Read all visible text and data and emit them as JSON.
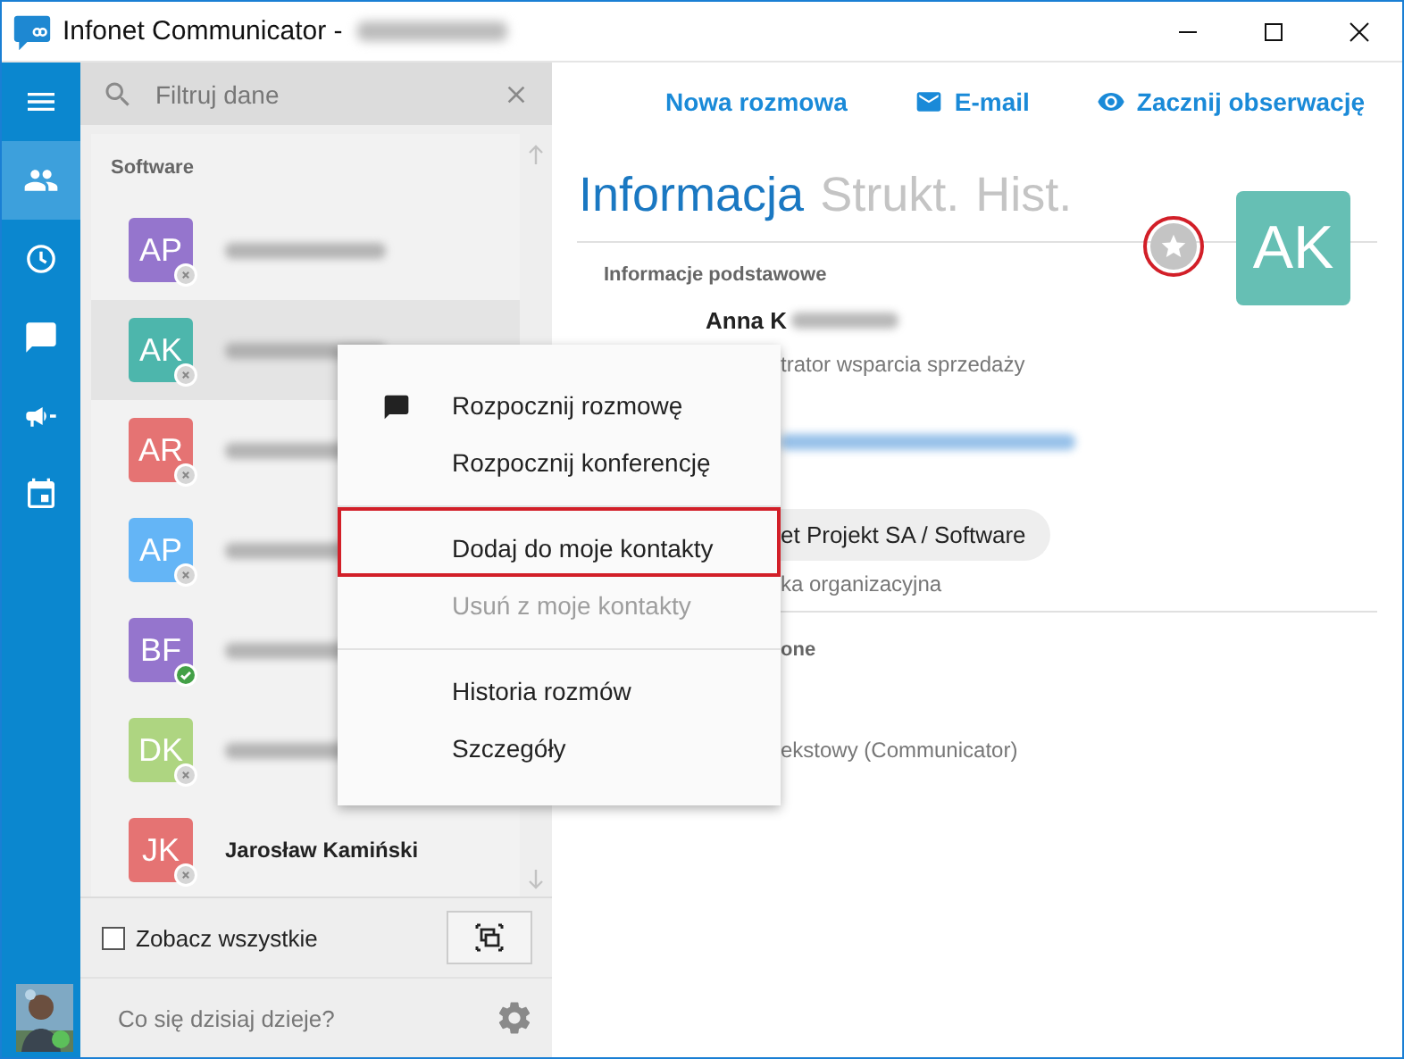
{
  "window": {
    "title": "Infonet Communicator -"
  },
  "rail": {
    "items": [
      {
        "kind": "menu",
        "selected": false
      },
      {
        "kind": "contacts",
        "selected": true
      },
      {
        "kind": "history",
        "selected": false
      },
      {
        "kind": "chats",
        "selected": false
      },
      {
        "kind": "announcements",
        "selected": false
      },
      {
        "kind": "calendar",
        "selected": false
      }
    ]
  },
  "search": {
    "placeholder": "Filtruj dane"
  },
  "contacts": {
    "group": "Software",
    "items": [
      {
        "initials": "AP",
        "color": "#9575cd",
        "online": false,
        "selected": false
      },
      {
        "initials": "AK",
        "color": "#4db6ac",
        "online": false,
        "selected": true
      },
      {
        "initials": "AR",
        "color": "#e57373",
        "online": false,
        "selected": false
      },
      {
        "initials": "AP",
        "color": "#64b5f6",
        "online": false,
        "selected": false
      },
      {
        "initials": "BF",
        "color": "#9575cd",
        "online": true,
        "selected": false
      },
      {
        "initials": "DK",
        "color": "#aed581",
        "online": false,
        "selected": false
      },
      {
        "initials": "JK",
        "color": "#e57373",
        "online": false,
        "selected": false,
        "name": "Jarosław Kamiński"
      }
    ]
  },
  "show_all": {
    "label": "Zobacz wszystkie",
    "checked": false
  },
  "status_field": {
    "placeholder": "Co się dzisiaj dzieje?"
  },
  "actions": [
    {
      "kind": "chat",
      "label": "Nowa rozmowa"
    },
    {
      "kind": "email",
      "label": "E-mail"
    },
    {
      "kind": "watch",
      "label": "Zacznij obserwację"
    }
  ],
  "tabs": [
    {
      "label": "Informacja",
      "selected": true
    },
    {
      "label": "Strukt.",
      "selected": false
    },
    {
      "label": "Hist.",
      "selected": false
    }
  ],
  "profile": {
    "initials": "AK",
    "color": "#66bfb4",
    "favorite": false,
    "favorite_highlighted": true,
    "name": "Anna K",
    "job_title": "trator wsparcia sprzedaży",
    "unit": "et Projekt SA / Software",
    "unit_label": "ka organizacyjna"
  },
  "sections": [
    {
      "title": "Informacje podstawowe"
    },
    {
      "title": "one",
      "detail": "ekstowy (Communicator)"
    }
  ],
  "context_menu": {
    "groups": [
      {
        "items": [
          {
            "label": "Rozpocznij rozmowę",
            "kind": "chat",
            "disabled": false,
            "highlighted": false
          },
          {
            "label": "Rozpocznij konferencję",
            "kind": "plain",
            "disabled": false,
            "highlighted": false
          }
        ]
      },
      {
        "items": [
          {
            "label": "Dodaj do moje kontakty",
            "kind": "plain",
            "disabled": false,
            "highlighted": true
          },
          {
            "label": "Usuń z moje kontakty",
            "kind": "plain",
            "disabled": true,
            "highlighted": false
          }
        ]
      },
      {
        "items": [
          {
            "label": "Historia rozmów",
            "kind": "plain",
            "disabled": false,
            "highlighted": false
          },
          {
            "label": "Szczegóły",
            "kind": "plain",
            "disabled": false,
            "highlighted": false
          }
        ]
      }
    ]
  }
}
